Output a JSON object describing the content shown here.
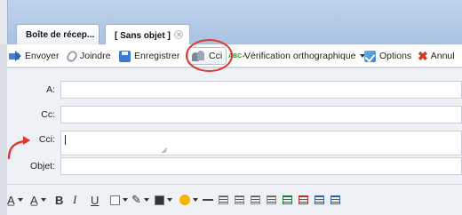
{
  "tabs": [
    {
      "label": "Boîte de récep..."
    },
    {
      "label": "[ Sans objet ]"
    }
  ],
  "toolbar": {
    "send": "Envoyer",
    "attach": "Joindre",
    "save": "Enregistrer",
    "bcc": "Cci",
    "spellcheck": "Vérification orthographique",
    "options": "Options",
    "cancel": "Annul"
  },
  "form": {
    "to_label": "A:",
    "cc_label": "Cc:",
    "bcc_label": "Cci:",
    "subject_label": "Objet:"
  },
  "format": {
    "bold": "B",
    "italic": "I",
    "underline": "U"
  },
  "colors": {
    "annotation": "#e2352b",
    "tab_band": "#a9c2e2"
  }
}
